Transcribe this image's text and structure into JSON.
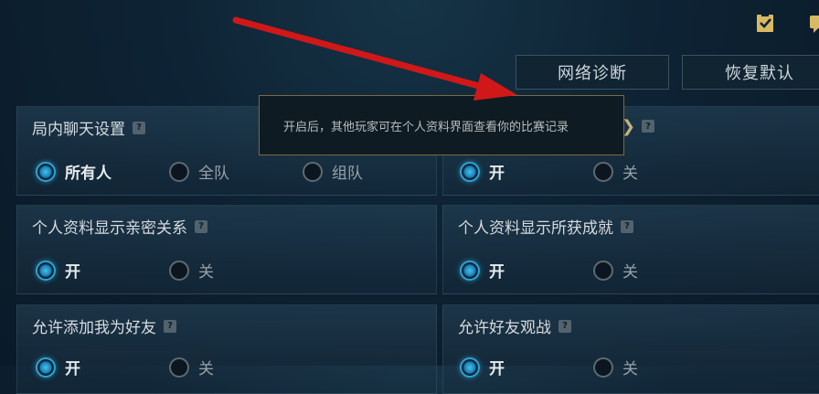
{
  "toolbar": {
    "network_button": "网络诊断",
    "reset_button": "恢复默认",
    "icons": [
      "clipboard-check-icon",
      "chat-icon"
    ]
  },
  "tooltip": {
    "text": "开启后，其他玩家可在个人资料界面查看你的比赛记录"
  },
  "panels": [
    {
      "title": "局内聊天设置",
      "options": [
        "所有人",
        "全队",
        "组队"
      ],
      "selected": 0
    },
    {
      "title": "",
      "options": [
        "开",
        "关"
      ],
      "selected": 0
    },
    {
      "title": "个人资料显示亲密关系",
      "options": [
        "开",
        "关"
      ],
      "selected": 0
    },
    {
      "title": "个人资料显示所获成就",
      "options": [
        "开",
        "关"
      ],
      "selected": 0
    },
    {
      "title": "允许添加我为好友",
      "options": [
        "开",
        "关"
      ],
      "selected": 0
    },
    {
      "title": "允许好友观战",
      "options": [
        "开",
        "关"
      ],
      "selected": 0
    }
  ],
  "help_mark": "?",
  "colors": {
    "accent": "#2ea3d6",
    "tooltip_border": "#7d6a3f",
    "annotation_arrow": "#d01818"
  }
}
